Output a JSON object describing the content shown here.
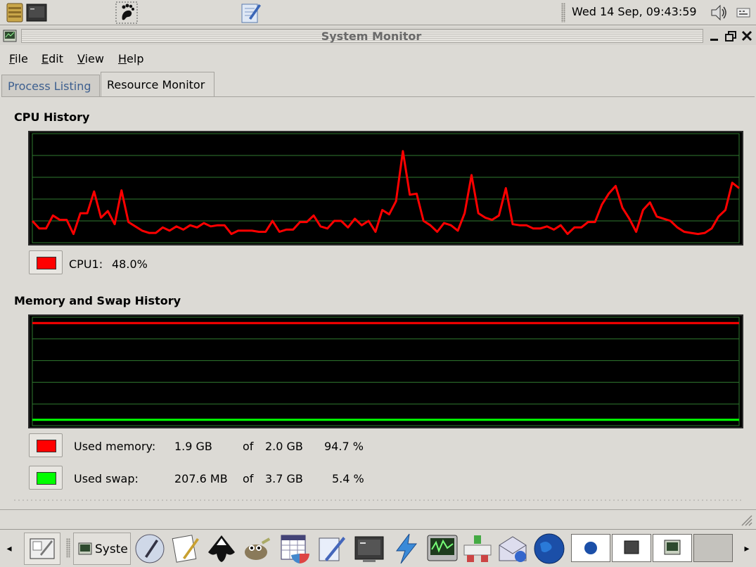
{
  "top_panel": {
    "clock": "Wed 14 Sep, 09:43:59",
    "launchers": [
      "archive-icon",
      "terminal-icon",
      "gnome-foot-icon",
      "text-editor-icon"
    ],
    "tray": [
      "volume-icon",
      "keyboard-icon"
    ]
  },
  "window": {
    "title": "System Monitor",
    "controls": [
      "minimize-icon",
      "restore-icon",
      "close-icon"
    ]
  },
  "menu": {
    "file": "File",
    "edit": "Edit",
    "view": "View",
    "help": "Help"
  },
  "tabs": {
    "process": "Process Listing",
    "resource": "Resource Monitor",
    "active": "Resource Monitor"
  },
  "cpu": {
    "title": "CPU History",
    "legend_label": "CPU1:",
    "legend_value": "48.0%",
    "color": "#ff0000"
  },
  "memory": {
    "title": "Memory and Swap History",
    "mem_label": "Used memory:",
    "mem_used": "1.9 GB",
    "mem_of": "of",
    "mem_total": "2.0 GB",
    "mem_percent": "94.7 %",
    "mem_color": "#ff0000",
    "swap_label": "Used swap:",
    "swap_used": "207.6 MB",
    "swap_of": "of",
    "swap_total": "3.7 GB",
    "swap_percent": "5.4 %",
    "swap_color": "#00ff00"
  },
  "taskbar": {
    "task_label": "Syste",
    "launchers": [
      "notes-icon",
      "text-editor-icon",
      "notepad-icon",
      "inkscape-icon",
      "gimp-icon",
      "spreadsheet-icon",
      "drawing-icon",
      "terminal-icon",
      "lightning-icon",
      "system-monitor-icon",
      "network-icon",
      "mail-icon",
      "browser-globe-icon"
    ]
  },
  "chart_data": [
    {
      "type": "line",
      "title": "CPU History",
      "ylim": [
        0,
        100
      ],
      "grid": true,
      "series": [
        {
          "name": "CPU1",
          "values": [
            20,
            13,
            13,
            25,
            21,
            21,
            8,
            27,
            27,
            47,
            23,
            29,
            17,
            48,
            19,
            15,
            11,
            9,
            9,
            14,
            11,
            15,
            12,
            16,
            14,
            18,
            15,
            16,
            16,
            8,
            11,
            11,
            11,
            10,
            10,
            20,
            10,
            12,
            12,
            19,
            19,
            25,
            15,
            13,
            20,
            20,
            14,
            22,
            16,
            20,
            10,
            30,
            26,
            38,
            84,
            44,
            45,
            20,
            16,
            10,
            18,
            16,
            11,
            27,
            62,
            27,
            23,
            21,
            25,
            50,
            17,
            16,
            16,
            13,
            13,
            15,
            12,
            16,
            8,
            14,
            14,
            19,
            19,
            35,
            45,
            52,
            32,
            22,
            10,
            30,
            37,
            24,
            22,
            20,
            14,
            10,
            9,
            8,
            9,
            13,
            24,
            30,
            55,
            50
          ]
        }
      ]
    },
    {
      "type": "line",
      "title": "Memory and Swap History",
      "ylim": [
        0,
        100
      ],
      "grid": true,
      "series": [
        {
          "name": "Used memory",
          "values": [
            94.7,
            94.7
          ]
        },
        {
          "name": "Used swap",
          "values": [
            5.4,
            5.4
          ]
        }
      ]
    }
  ]
}
